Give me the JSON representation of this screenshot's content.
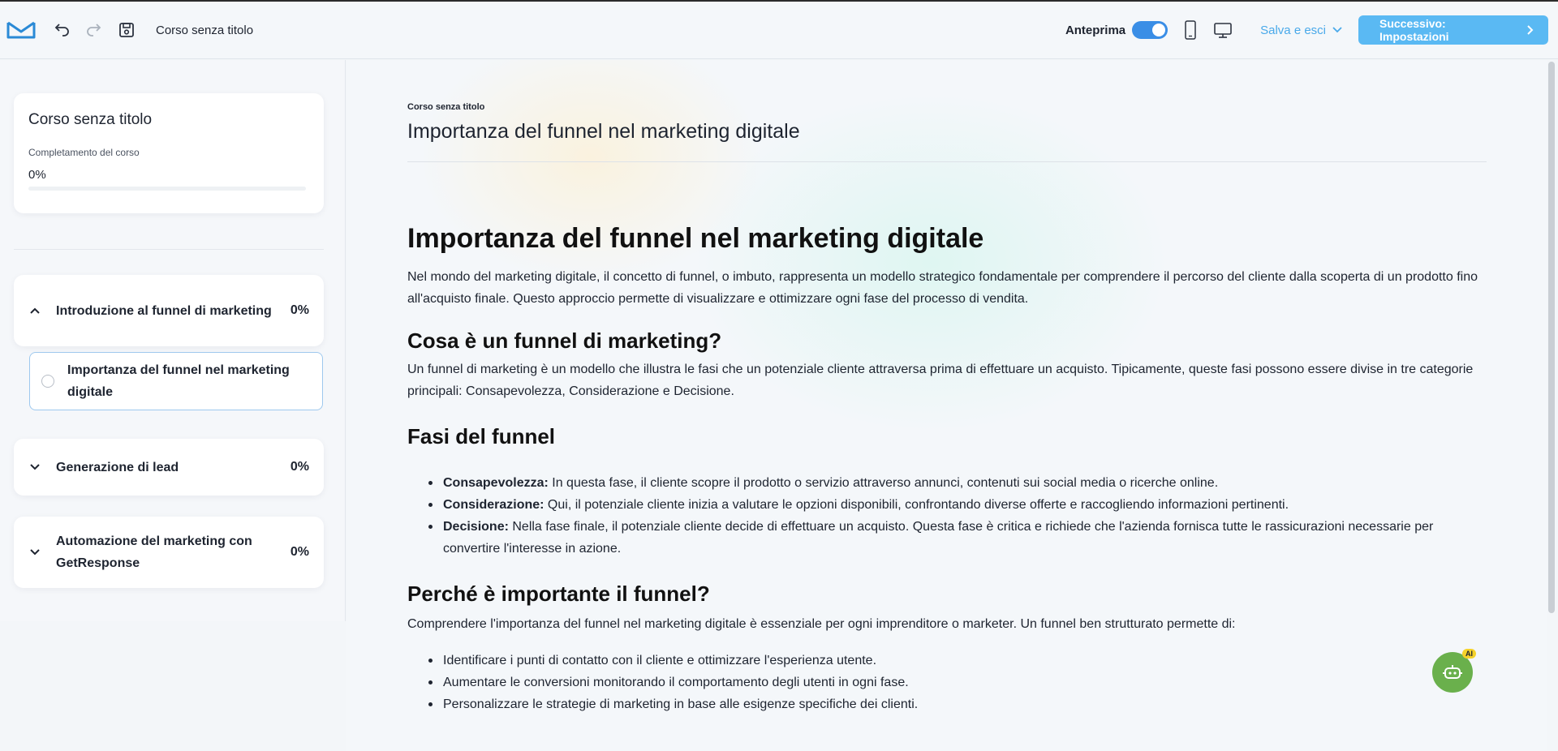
{
  "topbar": {
    "doc_title": "Corso senza titolo",
    "preview_label": "Anteprima",
    "save_exit_label": "Salva e esci",
    "next_label": "Successivo: Impostazioni"
  },
  "sidebar": {
    "course_title": "Corso senza titolo",
    "completion_label": "Completamento del corso",
    "completion_value": "0%",
    "completion_fraction": 0,
    "sections": [
      {
        "title": "Introduzione al funnel di marketing",
        "percent": "0%",
        "expanded": true
      },
      {
        "title": "Generazione di lead",
        "percent": "0%",
        "expanded": false
      },
      {
        "title": "Automazione del marketing con GetResponse",
        "percent": "0%",
        "expanded": false
      }
    ],
    "lessons": [
      {
        "title": "Importanza del funnel nel marketing digitale"
      }
    ]
  },
  "main": {
    "breadcrumb": "Corso senza titolo",
    "lesson_heading": "Importanza del funnel nel marketing digitale",
    "h1": "Importanza del funnel nel marketing digitale",
    "intro": "Nel mondo del marketing digitale, il concetto di funnel, o imbuto, rappresenta un modello strategico fondamentale per comprendere il percorso del cliente dalla scoperta di un prodotto fino all'acquisto finale. Questo approccio permette di visualizzare e ottimizzare ogni fase del processo di vendita.",
    "h2_what": "Cosa è un funnel di marketing?",
    "what_text": "Un funnel di marketing è un modello che illustra le fasi che un potenziale cliente attraversa prima di effettuare un acquisto. Tipicamente, queste fasi possono essere divise in tre categorie principali: Consapevolezza, Considerazione e Decisione.",
    "h2_phases": "Fasi del funnel",
    "phases": [
      {
        "term": "Consapevolezza:",
        "text": " In questa fase, il cliente scopre il prodotto o servizio attraverso annunci, contenuti sui social media o ricerche online."
      },
      {
        "term": "Considerazione:",
        "text": " Qui, il potenziale cliente inizia a valutare le opzioni disponibili, confrontando diverse offerte e raccogliendo informazioni pertinenti."
      },
      {
        "term": "Decisione:",
        "text": " Nella fase finale, il potenziale cliente decide di effettuare un acquisto. Questa fase è critica e richiede che l'azienda fornisca tutte le rassicurazioni necessarie per convertire l'interesse in azione."
      }
    ],
    "h2_why": "Perché è importante il funnel?",
    "why_text": "Comprendere l'importanza del funnel nel marketing digitale è essenziale per ogni imprenditore o marketer. Un funnel ben strutturato permette di:",
    "benefits": [
      "Identificare i punti di contatto con il cliente e ottimizzare l'esperienza utente.",
      "Aumentare le conversioni monitorando il comportamento degli utenti in ogni fase.",
      "Personalizzare le strategie di marketing in base alle esigenze specifiche dei clienti."
    ]
  },
  "ai_badge": "AI",
  "colors": {
    "accent": "#3a8ee6",
    "next_button": "#5ab9f3",
    "link": "#49a9ea",
    "ai_fab": "#6ab04c"
  },
  "icons": [
    "logo-envelope-icon",
    "undo-icon",
    "redo-icon",
    "save-icon",
    "mobile-icon",
    "desktop-icon",
    "chevron-down-icon",
    "chevron-right-icon",
    "chevron-up-icon",
    "robot-icon"
  ]
}
